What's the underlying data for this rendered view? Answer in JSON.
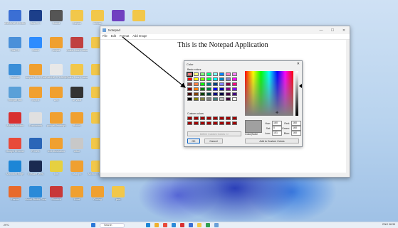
{
  "desktop": {
    "icons": [
      {
        "label": "ANDROID STUDIO",
        "color": "#3b6fd4"
      },
      {
        "label": "Dev-C++",
        "color": "#1c3f8a"
      },
      {
        "label": "Sound",
        "color": "#555555"
      },
      {
        "label": "Eclipse",
        "color": "#f2c74a"
      },
      {
        "label": "eclipse",
        "color": "#f2c74a"
      },
      {
        "label": "",
        "color": "#7040c0"
      },
      {
        "label": "",
        "color": "#f2c74a"
      },
      {
        "label": "This PC",
        "color": "#4a90d9"
      },
      {
        "label": "Zoom",
        "color": "#2d8cff"
      },
      {
        "label": "project",
        "color": "#f0a030"
      },
      {
        "label": "Online Learn management",
        "color": "#c04040"
      },
      {
        "label": "",
        "color": "#f2c74a"
      },
      {
        "label": "Network",
        "color": "#3a8ed8"
      },
      {
        "label": "Acquire 2022\\Tool",
        "color": "#f0a030"
      },
      {
        "label": "ONLINE STUDENTS",
        "color": "#e8e8e8"
      },
      {
        "label": "Online Learn management",
        "color": "#f2c74a"
      },
      {
        "label": "",
        "color": "#f2c74a"
      },
      {
        "label": "Recycle Bin",
        "color": "#5aa0d8"
      },
      {
        "label": "project",
        "color": "#f0a030"
      },
      {
        "label": "web",
        "color": "#f0a030"
      },
      {
        "label": "UI Vault",
        "color": "#333333"
      },
      {
        "label": "",
        "color": "#f2c74a"
      },
      {
        "label": "Adobe Acrobat",
        "color": "#d83030"
      },
      {
        "label": "Documents",
        "color": "#e0e0e0"
      },
      {
        "label": "google drawings",
        "color": "#f0a030"
      },
      {
        "label": "Books",
        "color": "#f0a030"
      },
      {
        "label": "",
        "color": "#f2c74a"
      },
      {
        "label": "Google Chrome",
        "color": "#e84a3a"
      },
      {
        "label": "R 4.2.1",
        "color": "#2a66b8"
      },
      {
        "label": "web illustration",
        "color": "#f0a030"
      },
      {
        "label": "office",
        "color": "#c8c8c8"
      },
      {
        "label": "",
        "color": "#f2c74a"
      },
      {
        "label": "Microsoft Edge",
        "color": "#1d86d6"
      },
      {
        "label": "VMware View",
        "color": "#1a2a50"
      },
      {
        "label": "bits",
        "color": "#e6d040"
      },
      {
        "label": "backgrd",
        "color": "#f0a030"
      },
      {
        "label": "Android Emulator",
        "color": "#f2c74a"
      },
      {
        "label": "Firefox",
        "color": "#e86a2a"
      },
      {
        "label": "Visual Studio Code",
        "color": "#2a8ad8"
      },
      {
        "label": "Shortcut",
        "color": "#c83838"
      },
      {
        "label": "Local",
        "color": "#f0a030"
      },
      {
        "label": "Coding",
        "color": "#f0a030"
      },
      {
        "label": "java",
        "color": "#f2c74a"
      }
    ]
  },
  "notepad": {
    "title": "Notepad",
    "menu": [
      "File",
      "Edit",
      "Format",
      "Add Image"
    ],
    "content": "This is the Notepad Application",
    "controls": [
      "—",
      "☐",
      "✕"
    ]
  },
  "color_dialog": {
    "title": "Color",
    "close": "✕",
    "basic_colors_label": "Basic colors",
    "custom_colors_label": "Custom colors",
    "define_button": "Define Custom Colors >>",
    "ok_button": "OK",
    "cancel_button": "Cancel",
    "color_solid_label": "Color|Solid",
    "add_custom_button": "Add to Custom Colors",
    "fields": {
      "hue_label": "Hue:",
      "hue": "160",
      "sat_label": "Sat:",
      "sat": "0",
      "lum_label": "Lum:",
      "lum": "151",
      "red_label": "Red:",
      "red": "160",
      "green_label": "Green:",
      "green": "160",
      "blue_label": "Blue:",
      "blue": "160"
    },
    "basic_colors": [
      "#ff8080",
      "#ffff80",
      "#80ff80",
      "#00ff80",
      "#80ffff",
      "#0080ff",
      "#ff80c0",
      "#ff80ff",
      "#ff0000",
      "#ffff00",
      "#80ff00",
      "#00ff40",
      "#00ffff",
      "#0080c0",
      "#8080c0",
      "#ff00ff",
      "#804040",
      "#ff8040",
      "#00ff00",
      "#008080",
      "#004080",
      "#8080ff",
      "#800040",
      "#ff0080",
      "#800000",
      "#ff8000",
      "#008000",
      "#008040",
      "#0000ff",
      "#0000a0",
      "#800080",
      "#8000ff",
      "#400000",
      "#804000",
      "#004000",
      "#004040",
      "#000080",
      "#000040",
      "#400040",
      "#400080",
      "#000000",
      "#808000",
      "#808040",
      "#808080",
      "#408080",
      "#c0c0c0",
      "#400040",
      "#ffffff"
    ],
    "custom_colors": [
      "#a00000",
      "#a00000",
      "#a00000",
      "#a00000",
      "#a00000",
      "#a00000",
      "#a00000",
      "#a00000",
      "#a00000",
      "#a00000",
      "#a00000",
      "#a00000",
      "#a00000",
      "#a00000",
      "#a00000",
      "#a00000"
    ]
  },
  "taskbar": {
    "weather": "29°C",
    "search_placeholder": "Search",
    "tray": "ENG  08:35"
  }
}
